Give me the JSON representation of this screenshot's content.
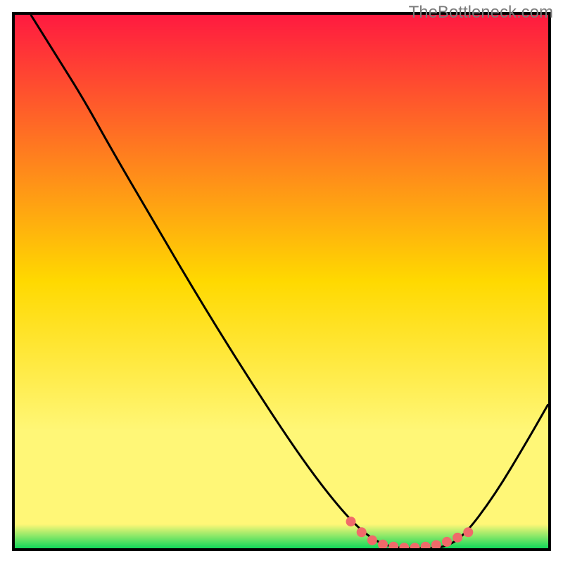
{
  "watermark": "TheBottleneck.com",
  "colors": {
    "gradient_top": "#ff1a40",
    "gradient_mid": "#ffd900",
    "gradient_low": "#fff777",
    "gradient_bottom": "#12d85a",
    "curve": "#000000",
    "marker_fill": "#f06a6a",
    "marker_stroke": "#c94f4f"
  },
  "chart_data": {
    "type": "line",
    "title": "",
    "xlabel": "",
    "ylabel": "",
    "xlim": [
      0,
      100
    ],
    "ylim": [
      0,
      100
    ],
    "grid": false,
    "legend": false,
    "curve": [
      {
        "x": 3,
        "y": 100
      },
      {
        "x": 8,
        "y": 92
      },
      {
        "x": 13,
        "y": 84
      },
      {
        "x": 18,
        "y": 75
      },
      {
        "x": 25,
        "y": 63
      },
      {
        "x": 35,
        "y": 46
      },
      {
        "x": 45,
        "y": 30
      },
      {
        "x": 55,
        "y": 15
      },
      {
        "x": 63,
        "y": 5
      },
      {
        "x": 68,
        "y": 1
      },
      {
        "x": 72,
        "y": 0
      },
      {
        "x": 76,
        "y": 0
      },
      {
        "x": 80,
        "y": 0
      },
      {
        "x": 84,
        "y": 2
      },
      {
        "x": 90,
        "y": 10
      },
      {
        "x": 96,
        "y": 20
      },
      {
        "x": 100,
        "y": 27
      }
    ],
    "highlight_points": [
      {
        "x": 63,
        "y": 5
      },
      {
        "x": 65,
        "y": 3
      },
      {
        "x": 67,
        "y": 1.5
      },
      {
        "x": 69,
        "y": 0.7
      },
      {
        "x": 71,
        "y": 0.3
      },
      {
        "x": 73,
        "y": 0.1
      },
      {
        "x": 75,
        "y": 0.1
      },
      {
        "x": 77,
        "y": 0.3
      },
      {
        "x": 79,
        "y": 0.6
      },
      {
        "x": 81,
        "y": 1.2
      },
      {
        "x": 83,
        "y": 2
      },
      {
        "x": 85,
        "y": 3
      }
    ],
    "gradient_stops": [
      {
        "offset": 0,
        "color_key": "gradient_top"
      },
      {
        "offset": 0.5,
        "color_key": "gradient_mid"
      },
      {
        "offset": 0.78,
        "color_key": "gradient_low"
      },
      {
        "offset": 0.955,
        "color_key": "gradient_low"
      },
      {
        "offset": 1.0,
        "color_key": "gradient_bottom"
      }
    ]
  }
}
